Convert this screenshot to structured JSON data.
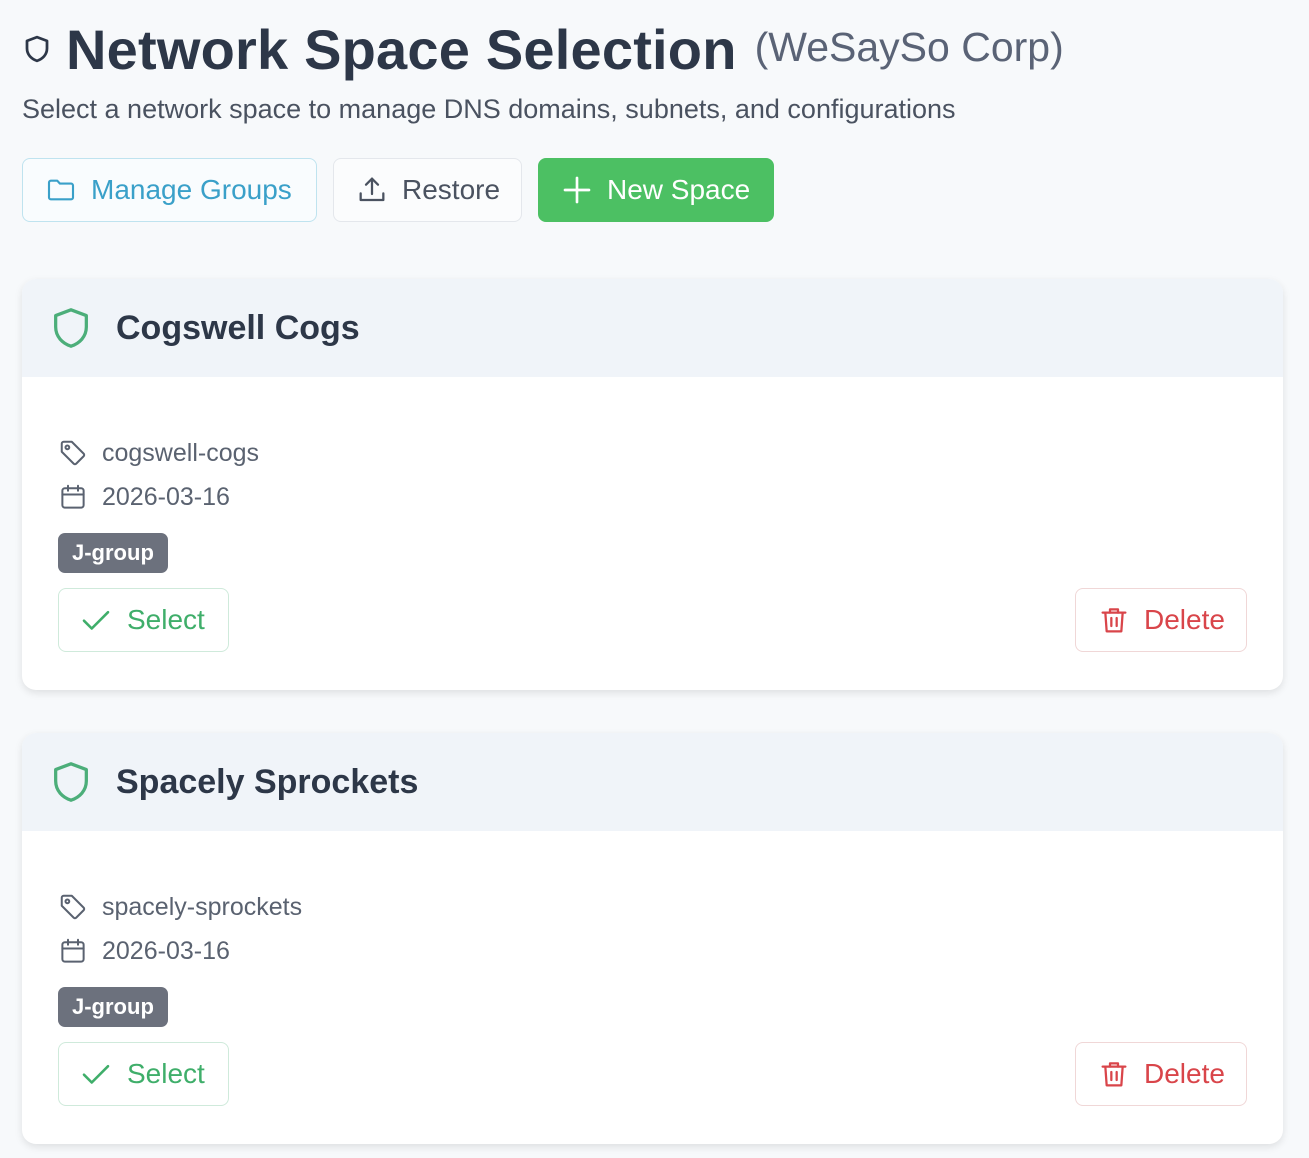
{
  "header": {
    "title": "Network Space Selection",
    "org": "(WeSaySo Corp)",
    "subtitle": "Select a network space to manage DNS domains, subnets, and configurations"
  },
  "toolbar": {
    "manage_groups_label": "Manage Groups",
    "restore_label": "Restore",
    "new_space_label": "New Space"
  },
  "colors": {
    "accent_green": "#4cc063",
    "accent_blue": "#3aa0c9",
    "danger_red": "#d9454a",
    "badge_gray": "#6c717d"
  },
  "spaces": [
    {
      "name": "Cogswell Cogs",
      "slug": "cogswell-cogs",
      "date": "2026-03-16",
      "group": "J-group",
      "select_label": "Select",
      "delete_label": "Delete"
    },
    {
      "name": "Spacely Sprockets",
      "slug": "spacely-sprockets",
      "date": "2026-03-16",
      "group": "J-group",
      "select_label": "Select",
      "delete_label": "Delete"
    }
  ],
  "icons": {
    "title": "shield-icon",
    "manage_groups": "folder-icon",
    "restore": "upload-icon",
    "new_space": "plus-icon",
    "card": "shield-icon",
    "slug": "tag-icon",
    "date": "calendar-icon",
    "select": "check-icon",
    "delete": "trash-icon"
  }
}
